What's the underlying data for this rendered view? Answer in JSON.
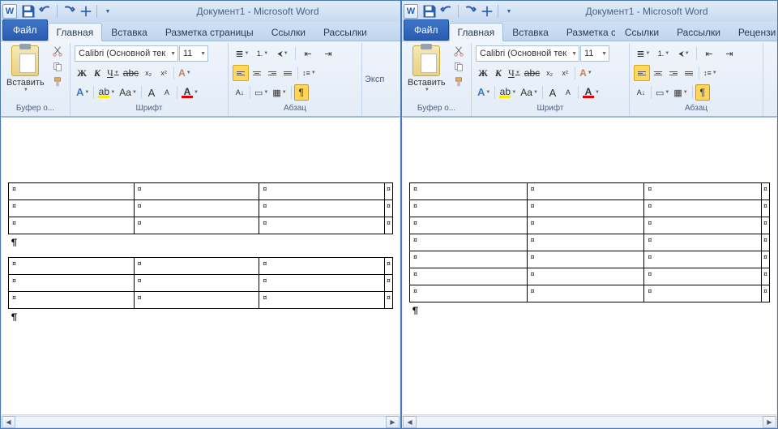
{
  "left": {
    "title": "Документ1  -  Microsoft Word",
    "qat": {
      "save": "save",
      "undo": "undo",
      "redo": "redo",
      "customize": "customize"
    },
    "tabs": {
      "file": "Файл",
      "items": [
        "Главная",
        "Вставка",
        "Разметка страницы",
        "Ссылки",
        "Рассылки"
      ],
      "active_index": 0
    },
    "ribbon": {
      "clipboard": {
        "paste": "Вставить",
        "label": "Буфер о..."
      },
      "font": {
        "name": "Calibri (Основной тек",
        "size": "11",
        "bold": "Ж",
        "italic": "К",
        "underline": "Ч",
        "strike": "abc",
        "sub": "x₂",
        "sup": "x²",
        "grow": "A",
        "shrink": "A",
        "case": "Aa",
        "clear": "A",
        "styleA": "A",
        "colorA": "A",
        "label": "Шрифт"
      },
      "paragraph": {
        "label": "Абзац",
        "pilcrow": "¶"
      },
      "cut_label": "Эксп"
    },
    "doc": {
      "table1_rows": 3,
      "table1_cols": 3,
      "table2_rows": 3,
      "table2_cols": 3,
      "cell_mark": "¤",
      "row_end_mark": "¤",
      "para1": "¶",
      "para2": "¶"
    }
  },
  "right": {
    "title": "Документ1  -  Microsoft Word",
    "tabs": {
      "file": "Файл",
      "items": [
        "Главная",
        "Вставка",
        "Разметка страниц",
        "Ссылки",
        "Рассылки",
        "Рецензиро"
      ],
      "active_index": 0
    },
    "ribbon": {
      "clipboard": {
        "paste": "Вставить",
        "label": "Буфер о..."
      },
      "font": {
        "name": "Calibri (Основной тек",
        "size": "11",
        "bold": "Ж",
        "italic": "К",
        "underline": "Ч",
        "strike": "abc",
        "sub": "x₂",
        "sup": "x²",
        "grow": "A",
        "shrink": "A",
        "case": "Aa",
        "clear": "A",
        "styleA": "A",
        "colorA": "A",
        "label": "Шрифт"
      },
      "paragraph": {
        "label": "Абзац",
        "pilcrow": "¶"
      }
    },
    "doc": {
      "table_rows": 7,
      "table_cols": 3,
      "cell_mark": "¤",
      "row_end_mark": "¤",
      "para": "¶"
    }
  }
}
